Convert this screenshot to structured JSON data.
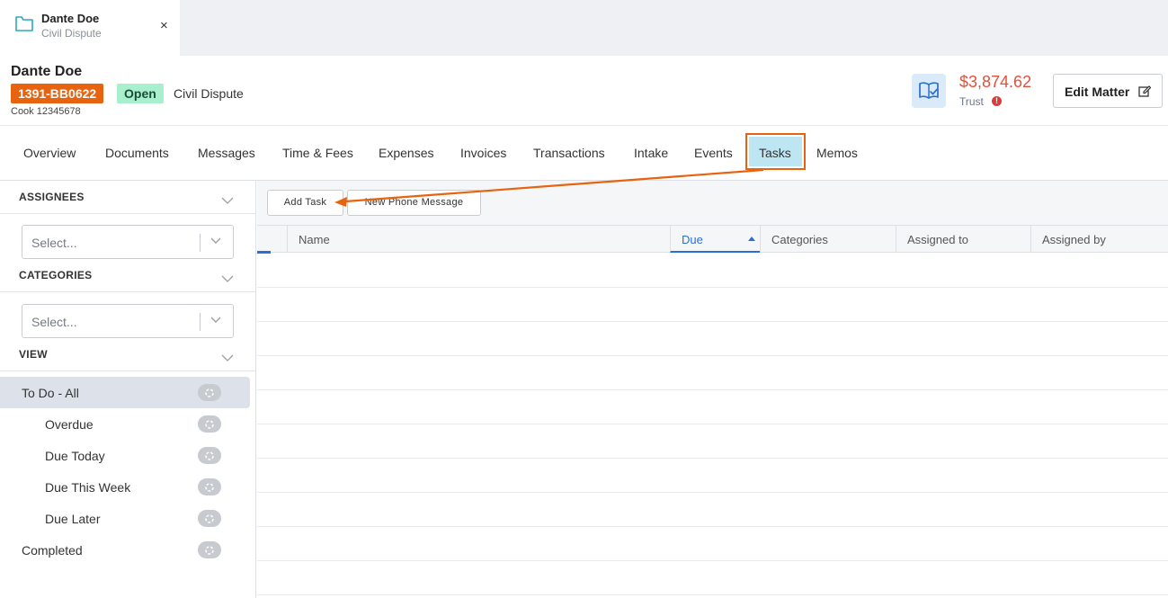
{
  "matter_tab": {
    "title": "Dante Doe",
    "subtitle": "Civil Dispute",
    "close": "×"
  },
  "header": {
    "client_name": "Dante Doe",
    "matter_number": "1391-BB0622",
    "status": "Open",
    "matter_type": "Civil Dispute",
    "sub_line": "Cook 12345678",
    "trust_amount": "$3,874.62",
    "trust_label": "Trust",
    "trust_alert": "!",
    "edit_button": "Edit Matter",
    "colors": {
      "matter_badge": "#e8630f",
      "status_badge": "#a8efce",
      "trust_amount": "#e0513c"
    }
  },
  "nav": {
    "tabs": [
      {
        "label": "Overview"
      },
      {
        "label": "Documents"
      },
      {
        "label": "Messages"
      },
      {
        "label": "Time & Fees"
      },
      {
        "label": "Expenses"
      },
      {
        "label": "Invoices"
      },
      {
        "label": "Transactions"
      },
      {
        "label": "Intake"
      },
      {
        "label": "Events"
      },
      {
        "label": "Tasks"
      },
      {
        "label": "Memos"
      }
    ],
    "active": "Tasks"
  },
  "sidebar": {
    "assignees": {
      "title": "ASSIGNEES",
      "placeholder": "Select..."
    },
    "categories": {
      "title": "CATEGORIES",
      "placeholder": "Select..."
    },
    "view": {
      "title": "VIEW",
      "items": [
        {
          "label": "To Do - All"
        },
        {
          "label": "Overdue"
        },
        {
          "label": "Due Today"
        },
        {
          "label": "Due This Week"
        },
        {
          "label": "Due Later"
        },
        {
          "label": "Completed"
        }
      ],
      "selected": "To Do - All"
    }
  },
  "main": {
    "toolbar": {
      "add_task": "Add Task",
      "new_phone_message": "New Phone Message"
    },
    "columns": [
      "Name",
      "Due",
      "Categories",
      "Assigned to",
      "Assigned by"
    ],
    "sorted_column": "Due"
  },
  "icons": {
    "matter_tab": "folder-icon",
    "trust": "book-check-icon",
    "edit": "edit-icon",
    "count": "loading-spinner-icon",
    "section_toggle": "chevron-down-icon"
  },
  "accent_colors": {
    "highlight": "#e8630f",
    "active_tab_bg": "#bde6f2",
    "sort": "#2a6fd6"
  }
}
